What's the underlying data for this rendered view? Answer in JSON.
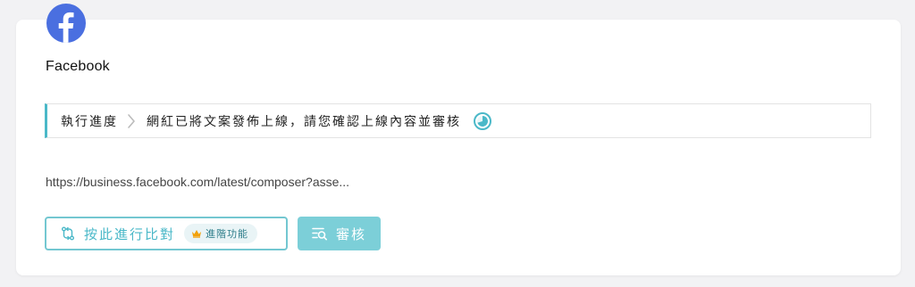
{
  "platform": {
    "name": "Facebook",
    "icon": "facebook-icon",
    "brand_color": "#4a6fe0"
  },
  "progress": {
    "label": "執行進度",
    "status": "網紅已將文案發佈上線，請您確認上線內容並審核",
    "accent_color": "#4ab8c8",
    "separator_icon": "chevron-right-icon",
    "status_icon": "clock-progress-icon"
  },
  "post": {
    "url": "https://business.facebook.com/latest/composer?asse..."
  },
  "actions": {
    "compare_label": "按此進行比對",
    "compare_icon": "compare-arrows-icon",
    "premium_label": "進階功能",
    "premium_icon": "crown-icon",
    "review_label": "審核",
    "review_icon": "search-list-icon"
  }
}
